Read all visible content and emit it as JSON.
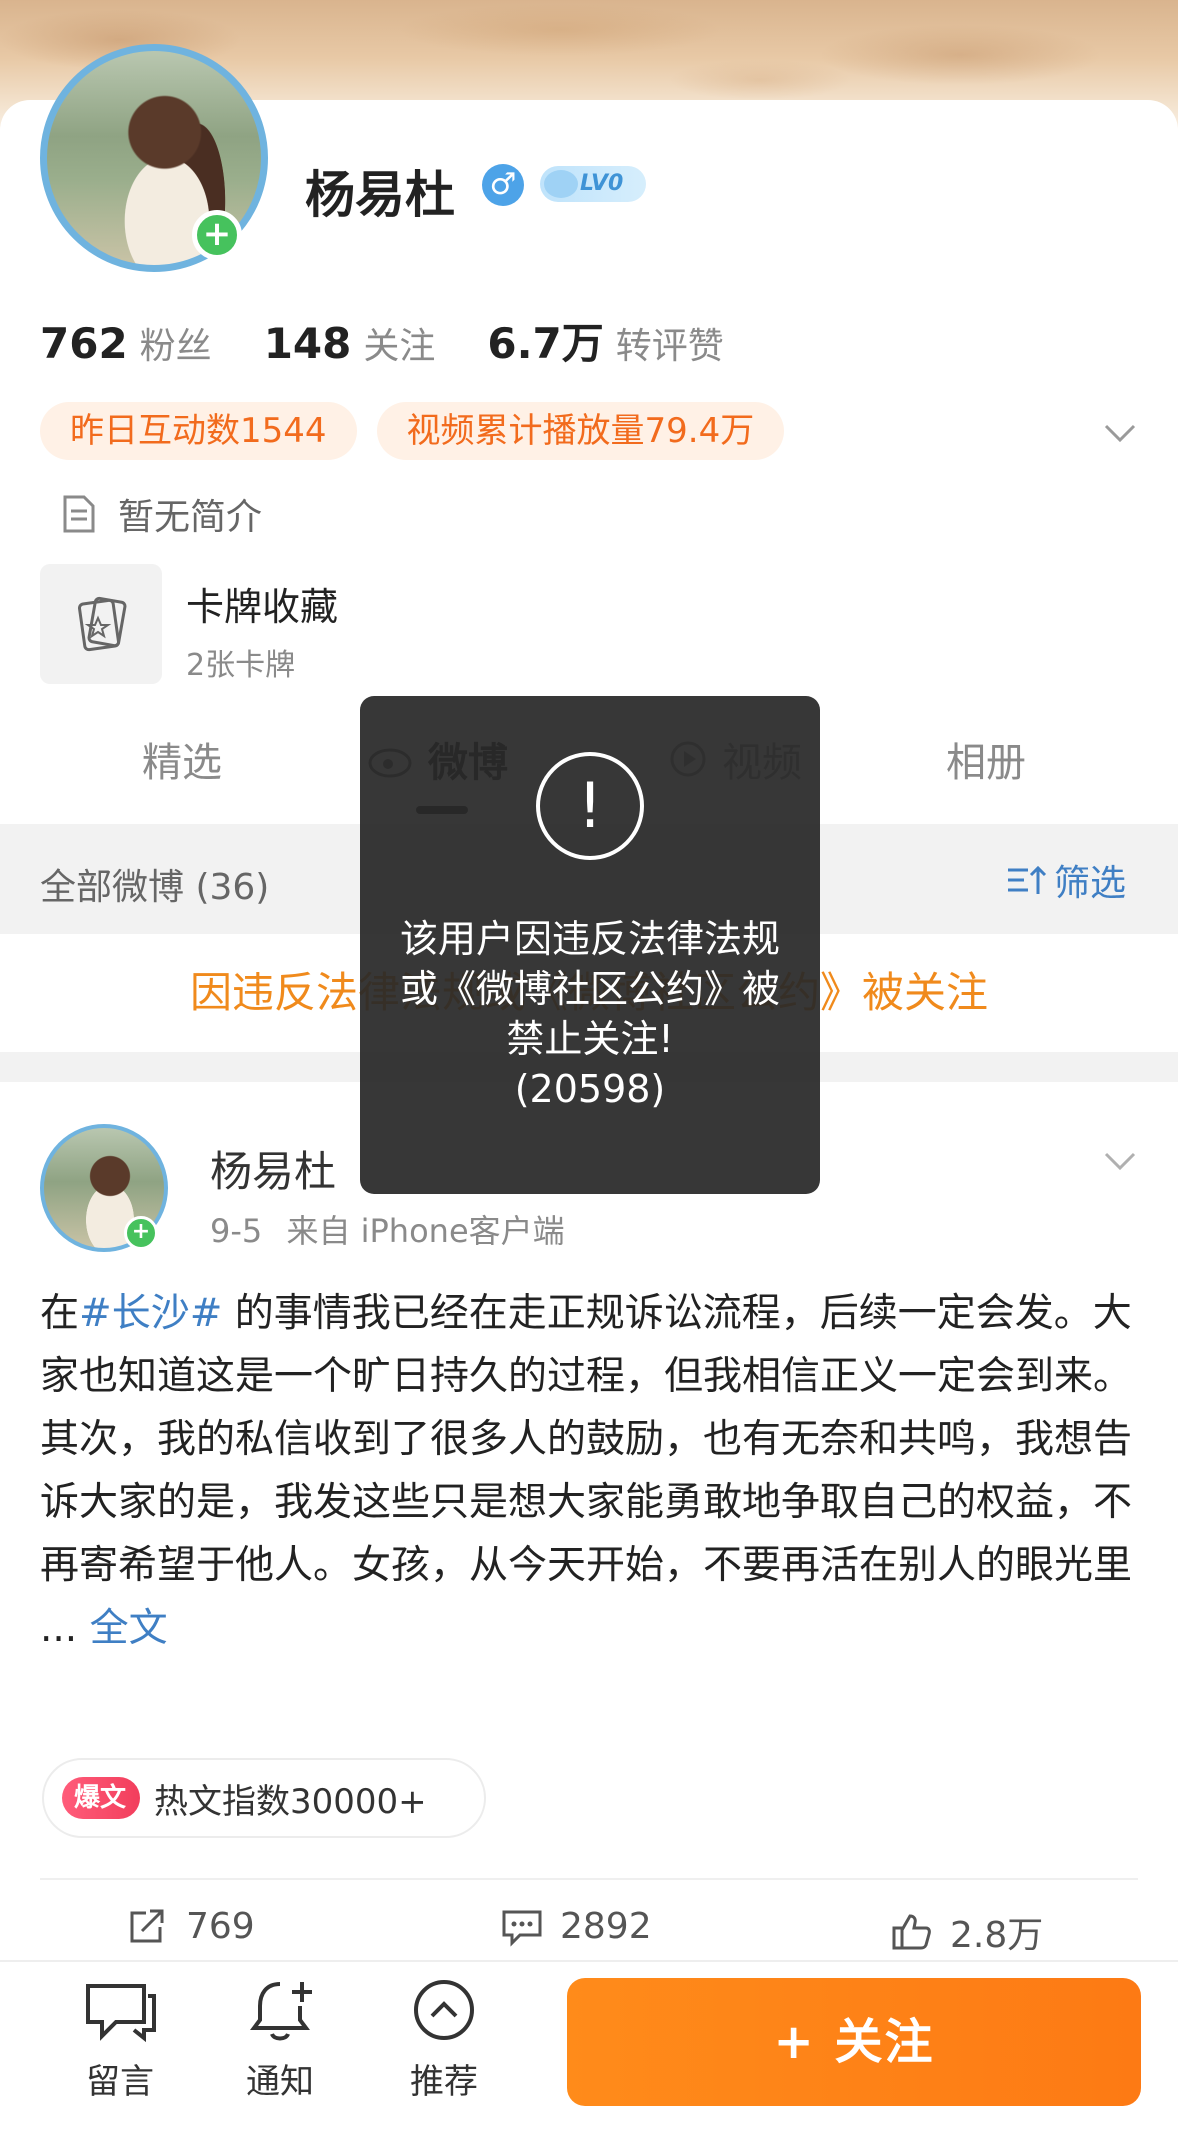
{
  "profile": {
    "name": "杨易杜",
    "gender_icon": "male-icon",
    "level": "LV0",
    "stats": [
      {
        "num": "762",
        "label": "粉丝"
      },
      {
        "num": "148",
        "label": "关注"
      },
      {
        "num": "6.7万",
        "label": "转评赞"
      }
    ],
    "pills": [
      "昨日互动数1544",
      "视频累计播放量79.4万"
    ],
    "bio": "暂无简介",
    "cards": {
      "title": "卡牌收藏",
      "subtitle": "2张卡牌"
    }
  },
  "tabs": [
    "精选",
    "微博",
    "视频",
    "相册"
  ],
  "filter": {
    "left": "全部微博 (36)",
    "right": "筛选"
  },
  "notice": "因违反法律法规或《微博社区公约》被关注",
  "post": {
    "author": "杨易杜",
    "date": "9-5",
    "source": "来自 iPhone客户端",
    "body": {
      "p1_prefix": "在",
      "p1_topic": "#长沙#",
      "p1_rest": " 的事情我已经在走正规诉讼流程，后续一定会发。大家也知道这是一个旷日持久的过程，但我相信正义一定会到来。",
      "p2": "其次，我的私信收到了很多人的鼓励，也有无奈和共鸣，我想告诉大家的是，我发这些只是想大家能勇敢地争取自己的权益，不再寄希望于他人。女孩，从今天开始，不要再活在别人的眼光里 ... ",
      "more": "全文"
    },
    "hot": {
      "badge": "爆文",
      "text": "热文指数30000+"
    },
    "actions": {
      "repost": "769",
      "comment": "2892",
      "like": "2.8万"
    }
  },
  "bottom_bar": {
    "items": [
      "留言",
      "通知",
      "推荐"
    ],
    "follow": "+ 关注"
  },
  "toast": {
    "message": "该用户因违反法律法规或《微博社区公约》被禁止关注!",
    "code": "(20598)"
  },
  "colors": {
    "accent_orange": "#f26b1d",
    "link_blue": "#3f7fc4",
    "follow_button": "#ff8b1a"
  }
}
